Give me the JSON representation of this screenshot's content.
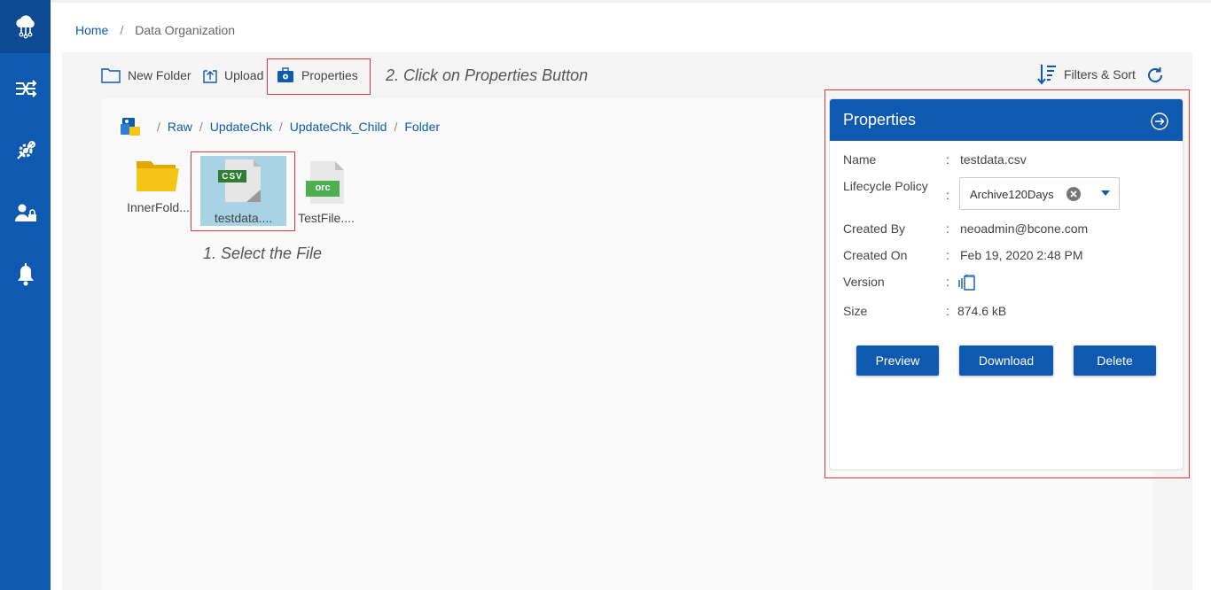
{
  "breadcrumb": {
    "home": "Home",
    "separator": "/",
    "current": "Data Organization"
  },
  "sidebar": {
    "items": [
      {
        "icon": "cloud-network-icon",
        "active": true
      },
      {
        "icon": "shuffle-icon",
        "active": false
      },
      {
        "icon": "settings-gear-icon",
        "active": false
      },
      {
        "icon": "user-lock-icon",
        "active": false
      },
      {
        "icon": "bell-icon",
        "active": false
      }
    ]
  },
  "toolbar": {
    "new_folder": "New Folder",
    "upload": "Upload",
    "properties": "Properties",
    "filters_sort": "Filters & Sort"
  },
  "annotations": {
    "step2": "2. Click on Properties Button",
    "step1": "1. Select the File"
  },
  "path": {
    "segments": [
      "Raw",
      "UpdateChk",
      "UpdateChk_Child",
      "Folder"
    ],
    "separator": "/"
  },
  "files": [
    {
      "name": "InnerFold...",
      "type": "folder",
      "selected": false
    },
    {
      "name": "testdata....",
      "type": "csv",
      "badge": "CSV",
      "selected": true
    },
    {
      "name": "TestFile....",
      "type": "orc",
      "badge": "orc",
      "selected": false
    }
  ],
  "properties": {
    "title": "Properties",
    "colon": ":",
    "name_label": "Name",
    "name_value": "testdata.csv",
    "lifecycle_label": "Lifecycle Policy",
    "lifecycle_value": "Archive120Days",
    "created_by_label": "Created By",
    "created_by_value": "neoadmin@bcone.com",
    "created_on_label": "Created On",
    "created_on_value": "Feb 19, 2020 2:48 PM",
    "version_label": "Version",
    "size_label": "Size",
    "size_value": "874.6 kB",
    "preview_button": "Preview",
    "download_button": "Download",
    "delete_button": "Delete"
  },
  "colors": {
    "brand": "#1059b0",
    "annotation": "#e03a3a",
    "selection": "#a9d3e5",
    "folder": "#f5c518",
    "csv_badge": "#2e7d32",
    "orc_badge": "#4caf50"
  }
}
